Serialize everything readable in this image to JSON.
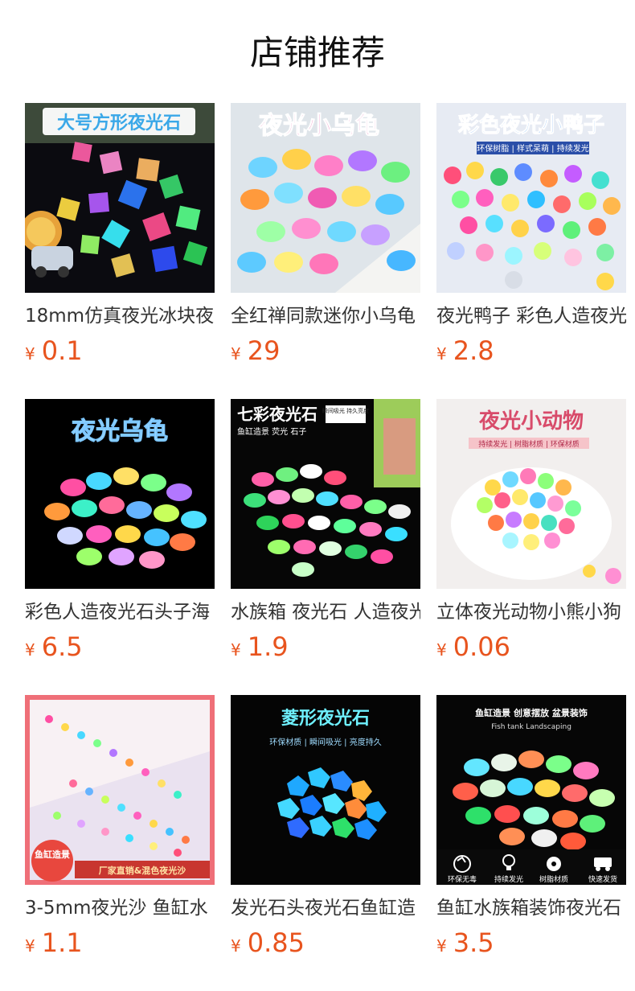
{
  "page_title": "店铺推荐",
  "currency_symbol": "¥",
  "accent_color": "#e8541e",
  "products": [
    {
      "title": "18mm仿真夜光冰块夜",
      "price": "0.1",
      "image_text": [
        "大号方形夜光石"
      ]
    },
    {
      "title": "全红禅同款迷你小乌龟",
      "price": "29",
      "image_text": [
        "夜光小乌龟"
      ]
    },
    {
      "title": "夜光鸭子 彩色人造夜光",
      "price": "2.8",
      "image_text": [
        "彩色夜光小鸭子",
        "环保树脂 | 样式呆萌 | 持续发光"
      ]
    },
    {
      "title": "彩色人造夜光石头子海",
      "price": "6.5",
      "image_text": [
        "夜光乌龟"
      ]
    },
    {
      "title": "水族箱 夜光石 人造夜光",
      "price": "1.9",
      "image_text": [
        "七彩夜光石",
        "瞬间吸光 持久亮度",
        "鱼缸造景 荧光 石子"
      ]
    },
    {
      "title": "立体夜光动物小熊小狗",
      "price": "0.06",
      "image_text": [
        "夜光小动物",
        "持续发光 | 树脂材质 | 环保材质"
      ]
    },
    {
      "title": "3-5mm夜光沙 鱼缸水",
      "price": "1.1",
      "image_text": [
        "鱼缸造景",
        "厂家直销&混色夜光沙"
      ]
    },
    {
      "title": "发光石头夜光石鱼缸造",
      "price": "0.85",
      "image_text": [
        "菱形夜光石",
        "环保材质 | 瞬间吸光 | 亮度持久"
      ]
    },
    {
      "title": "鱼缸水族箱装饰夜光石",
      "price": "3.5",
      "image_text": [
        "鱼缸造景 创意摆放 盆景装饰",
        "Fish tank Landscaping",
        "环保无毒",
        "持续发光",
        "树脂材质",
        "快速发货"
      ]
    }
  ]
}
